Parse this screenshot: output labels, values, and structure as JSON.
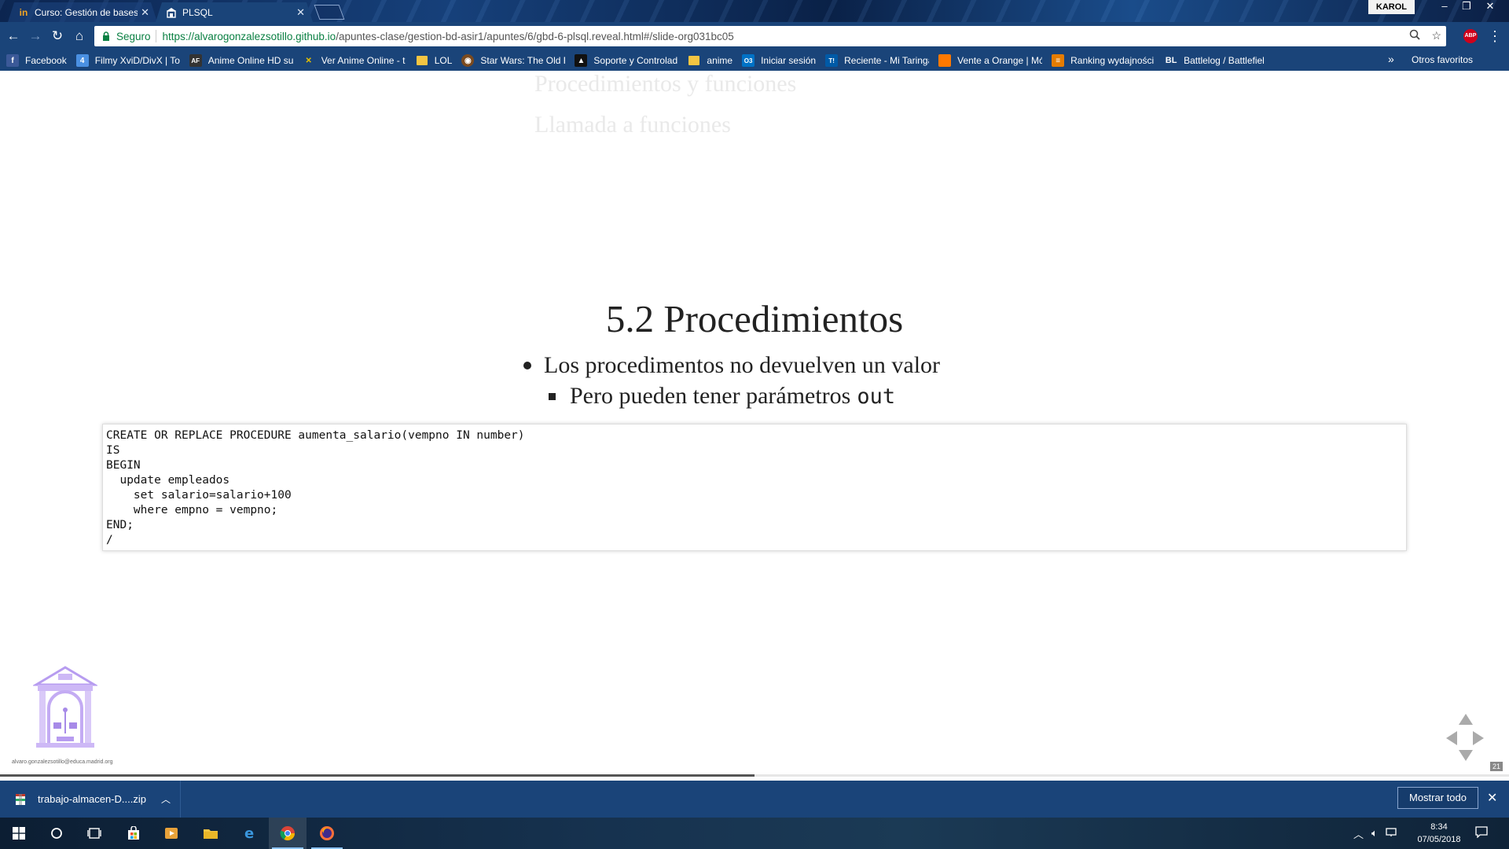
{
  "browser": {
    "tabs": [
      {
        "title": "Curso: Gestión de bases d",
        "favicon": "in",
        "active": false
      },
      {
        "title": "PLSQL",
        "favicon": "building",
        "active": true
      }
    ],
    "user_badge": "KAROL",
    "omnibox": {
      "secure_label": "Seguro",
      "url_scheme": "https://",
      "url_host": "alvarogonzalezsotillo.github.io",
      "url_path": "/apuntes-clase/gestion-bd-asir1/apuntes/6/gbd-6-plsql.reveal.html#/slide-org031bc05"
    },
    "extension_label": "ABP",
    "bookmarks": [
      {
        "label": "Facebook",
        "icon": "f",
        "icon_color": "#3b5998"
      },
      {
        "label": "Filmy XviD/DivX | To",
        "icon": "4",
        "icon_color": "#4a90e2"
      },
      {
        "label": "Anime Online HD su",
        "icon": "AF",
        "icon_color": "#333333"
      },
      {
        "label": "Ver Anime Online - t",
        "icon": "✕",
        "icon_color": "#c8a200"
      },
      {
        "label": "LOL",
        "icon": "folder",
        "icon_color": "#f4c542"
      },
      {
        "label": "Star Wars: The Old R",
        "icon": "◉",
        "icon_color": "#7a4a1f"
      },
      {
        "label": "Soporte y Controlad",
        "icon": "▲",
        "icon_color": "#222222"
      },
      {
        "label": "anime",
        "icon": "folder",
        "icon_color": "#f4c542"
      },
      {
        "label": "Iniciar sesión",
        "icon": "O3",
        "icon_color": "#0072c6"
      },
      {
        "label": "Reciente - Mi Taringa",
        "icon": "T!",
        "icon_color": "#005aa7"
      },
      {
        "label": "Vente a Orange | Mó",
        "icon": "",
        "icon_color": "#ff7900"
      },
      {
        "label": "Ranking wydajności",
        "icon": "≡",
        "icon_color": "#e57c00"
      },
      {
        "label": "Battlelog / Battlefiel",
        "icon": "BL",
        "icon_color": "#1a4479"
      }
    ],
    "other_bookmarks": "Otros favoritos"
  },
  "slide": {
    "ghost_line_1": "Procedimientos y funciones",
    "ghost_line_2": "Llamada a funciones",
    "title": "5.2 Procedimientos",
    "bullet_1": "Los procedimentos no devuelven un valor",
    "bullet_2_text": "Pero pueden tener parámetros",
    "bullet_2_code": "out",
    "code": "CREATE OR REPLACE PROCEDURE aumenta_salario(vempno IN number)\nIS\nBEGIN\n  update empleados\n    set salario=salario+100\n    where empno = vempno;\nEND;\n/",
    "footer_email": "alvaro.gonzalezsotillo@educa.madrid.org",
    "slide_number": "21",
    "progress_fraction": 0.5
  },
  "downloads": {
    "file_name": "trabajo-almacen-D....zip",
    "show_all_label": "Mostrar todo"
  },
  "taskbar": {
    "time": "8:34",
    "date": "07/05/2018"
  },
  "colors": {
    "chrome_frame": "#1a4479",
    "secure_green": "#0b8043",
    "slide_text": "#222222"
  }
}
